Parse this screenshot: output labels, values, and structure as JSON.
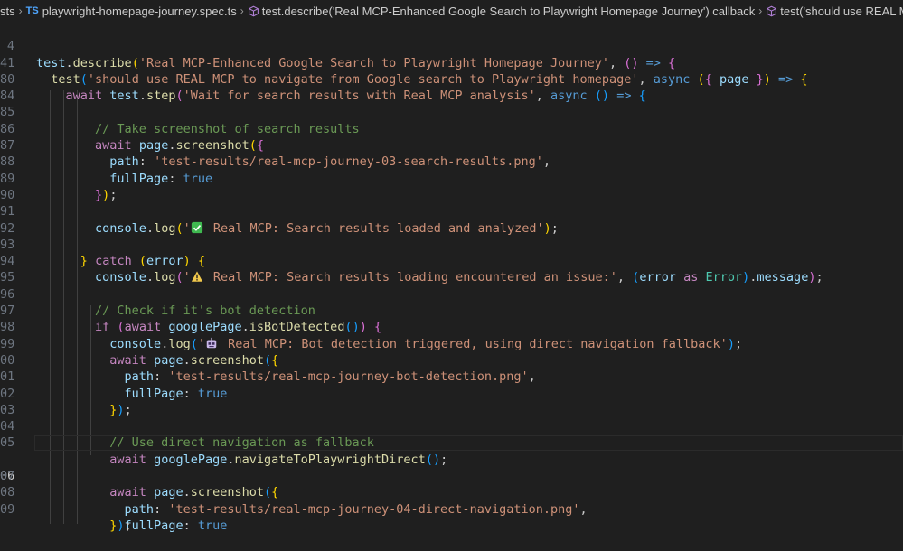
{
  "breadcrumb": {
    "folder": "sts",
    "file_badge": "TS",
    "file": "playwright-homepage-journey.spec.ts",
    "describe": "test.describe('Real MCP-Enhanced Google Search to Playwright Homepage Journey') callback",
    "test": "test('should use REAL MCP to"
  },
  "gutter": {
    "line_numbers": [
      "4",
      "41",
      "80",
      "84",
      "85",
      "86",
      "87",
      "88",
      "89",
      "90",
      "91",
      "92",
      "93",
      "94",
      "95",
      "96",
      "97",
      "98",
      "99",
      "00",
      "01",
      "02",
      "03",
      "04",
      "05",
      "06",
      "07",
      "08",
      "09"
    ]
  },
  "code": {
    "l4_fn": "test",
    "l4_method": "describe",
    "l4_str": "'Real MCP-Enhanced Google Search to Playwright Homepage Journey'",
    "l41_fn": "test",
    "l41_str": "'should use REAL MCP to navigate from Google search to Playwright homepage'",
    "l41_async": "async",
    "l41_page": "page",
    "l80_await": "await",
    "l80_test": "test",
    "l80_step": "step",
    "l80_str": "'Wait for search results with Real MCP analysis'",
    "l80_async": "async",
    "l84_comment": "// Take screenshot of search results",
    "l85_await": "await",
    "l85_page": "page",
    "l85_fn": "screenshot",
    "l86_key": "path",
    "l86_str": "'test-results/real-mcp-journey-03-search-results.png'",
    "l87_key": "fullPage",
    "l87_val": "true",
    "l90_console": "console",
    "l90_log": "log",
    "l90_str": " Real MCP: Search results loaded and analyzed'",
    "l92_catch": "catch",
    "l92_err": "error",
    "l93_console": "console",
    "l93_log": "log",
    "l93_str": " Real MCP: Search results loading encountered an issue:'",
    "l93_error": "error",
    "l93_as": "as",
    "l93_type": "Error",
    "l93_msg": "message",
    "l95_comment": "// Check if it's bot detection",
    "l96_if": "if",
    "l96_await": "await",
    "l96_obj": "googlePage",
    "l96_fn": "isBotDetected",
    "l97_console": "console",
    "l97_log": "log",
    "l97_str": " Real MCP: Bot detection triggered, using direct navigation fallback'",
    "l98_await": "await",
    "l98_page": "page",
    "l98_fn": "screenshot",
    "l99_key": "path",
    "l99_str": "'test-results/real-mcp-journey-bot-detection.png'",
    "l00_key": "fullPage",
    "l00_val": "true",
    "l03_comment": "// Use direct navigation as fallback",
    "l04_await": "await",
    "l04_obj": "googlePage",
    "l04_fn": "navigateToPlaywrightDirect",
    "l06_await": "await",
    "l06_page": "page",
    "l06_fn": "screenshot",
    "l07_key": "path",
    "l07_str": "'test-results/real-mcp-journey-04-direct-navigation.png'",
    "l08_key": "fullPage",
    "l08_val": "true"
  },
  "colors": {
    "background": "#1f1f1f",
    "keyword": "#569cd6",
    "control": "#c586c0",
    "function": "#dcdcaa",
    "string": "#ce9178",
    "variable": "#9cdcfe",
    "type": "#4ec9b0",
    "comment": "#6a9955"
  },
  "icons": [
    "typescript-file-icon",
    "symbol-method-icon",
    "check-mark-emoji",
    "warning-emoji",
    "robot-emoji"
  ]
}
